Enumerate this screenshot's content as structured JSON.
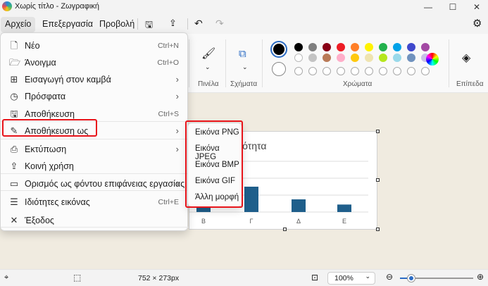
{
  "window": {
    "title": "Χωρίς τίτλο - Ζωγραφική"
  },
  "menubar": {
    "file": "Αρχείο",
    "edit": "Επεξεργασία",
    "view": "Προβολή"
  },
  "ribbon": {
    "brushes_label": "Πινέλα",
    "shapes_label": "Σχήματα",
    "colors_label": "Χρώματα",
    "layers_label": "Επίπεδα",
    "color_row1": [
      "#000000",
      "#7f7f7f",
      "#880015",
      "#ed1c24",
      "#ff7f27",
      "#fff200",
      "#22b14c",
      "#00a2e8",
      "#3f48cc",
      "#a349a4"
    ],
    "color_row2": [
      "#ffffff",
      "#c3c3c3",
      "#b97a57",
      "#ffaec9",
      "#ffc90e",
      "#efe4b0",
      "#b5e61d",
      "#99d9ea",
      "#7092be",
      "#c8bfe7"
    ]
  },
  "file_menu": {
    "items": [
      {
        "label": "Νέο",
        "shortcut": "Ctrl+N",
        "icon": "new-file-icon",
        "glyph": "🗋",
        "arrow": false
      },
      {
        "label": "Άνοιγμα",
        "shortcut": "Ctrl+O",
        "icon": "open-folder-icon",
        "glyph": "🗁",
        "arrow": false
      },
      {
        "label": "Εισαγωγή στον καμβά",
        "shortcut": "",
        "icon": "import-icon",
        "glyph": "⊞",
        "arrow": true
      },
      {
        "label": "Πρόσφατα",
        "shortcut": "",
        "icon": "clock-icon",
        "glyph": "◷",
        "arrow": true
      },
      {
        "label": "Αποθήκευση",
        "shortcut": "Ctrl+S",
        "icon": "save-icon",
        "glyph": "🖫",
        "arrow": false
      },
      {
        "label": "Αποθήκευση ως",
        "shortcut": "",
        "icon": "save-as-icon",
        "glyph": "✎",
        "arrow": true
      },
      {
        "label": "Εκτύπωση",
        "shortcut": "",
        "icon": "print-icon",
        "glyph": "⎙",
        "arrow": true
      },
      {
        "label": "Κοινή χρήση",
        "shortcut": "",
        "icon": "share-icon",
        "glyph": "⇪",
        "arrow": false
      },
      {
        "label": "Ορισμός ως φόντου επιφάνειας εργασίας",
        "shortcut": "",
        "icon": "wallpaper-icon",
        "glyph": "▭",
        "arrow": true
      },
      {
        "label": "Ιδιότητες εικόνας",
        "shortcut": "Ctrl+E",
        "icon": "properties-icon",
        "glyph": "☰",
        "arrow": false
      },
      {
        "label": "Έξοδος",
        "shortcut": "",
        "icon": "exit-icon",
        "glyph": "✕",
        "arrow": false
      }
    ]
  },
  "save_as_submenu": {
    "items": [
      "Εικόνα PNG",
      "Εικόνα JPEG",
      "Εικόνα BMP",
      "Εικόνα GIF",
      "Άλλη μορφή"
    ]
  },
  "canvas_chart": {
    "title_fragment": "ιότητα",
    "categories": [
      "Β",
      "Γ",
      "Δ",
      "Ε"
    ]
  },
  "chart_data": {
    "type": "bar",
    "categories": [
      "Β",
      "Γ",
      "Δ",
      "Ε"
    ],
    "values": [
      2,
      9,
      4.5,
      2.66
    ]
  },
  "status": {
    "dimensions": "752 × 273px",
    "zoom": "100%"
  }
}
